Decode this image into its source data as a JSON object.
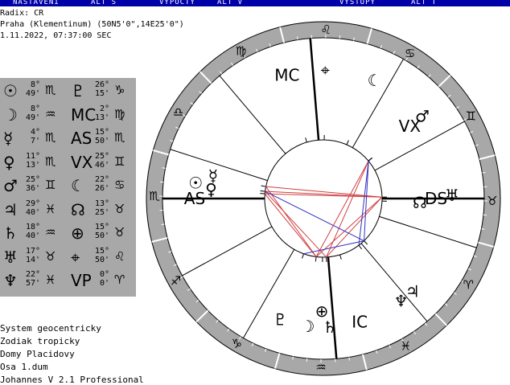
{
  "menu": [
    {
      "label": "NASTAVENI"
    },
    {
      "label": "ALT S"
    },
    {
      "label": "VYPOCTY"
    },
    {
      "label": "ALT V"
    },
    {
      "label": "VYSTUPY"
    },
    {
      "label": "ALT T"
    }
  ],
  "header": {
    "radix": "Radix: CR",
    "place": "Praha (Klementinum) (50N5'0\",14E25'0\")",
    "datetime": "1.11.2022, 07:37:00 SEC"
  },
  "table": [
    {
      "glyph": "☉",
      "deg": "8°",
      "min": "49'",
      "sign": "♏",
      "glyph2": "♇",
      "deg2": "26°",
      "min2": "15'",
      "sign2": "♑"
    },
    {
      "glyph": "☽",
      "deg": "8°",
      "min": "49'",
      "sign": "♒",
      "glyph2": "MC",
      "deg2": "2°",
      "min2": "13'",
      "sign2": "♍"
    },
    {
      "glyph": "☿",
      "deg": "4°",
      "min": "7'",
      "sign": "♏",
      "glyph2": "AS",
      "deg2": "15°",
      "min2": "50'",
      "sign2": "♏"
    },
    {
      "glyph": "♀",
      "deg": "11°",
      "min": "13'",
      "sign": "♏",
      "glyph2": "VX",
      "deg2": "25°",
      "min2": "46'",
      "sign2": "♊"
    },
    {
      "glyph": "♂",
      "deg": "25°",
      "min": "36'",
      "sign": "♊",
      "glyph2": "☾",
      "deg2": "22°",
      "min2": "26'",
      "sign2": "♋"
    },
    {
      "glyph": "♃",
      "deg": "29°",
      "min": "40'",
      "sign": "♓",
      "glyph2": "☊",
      "deg2": "13°",
      "min2": "25'",
      "sign2": "♉"
    },
    {
      "glyph": "♄",
      "deg": "18°",
      "min": "40'",
      "sign": "♒",
      "glyph2": "⊕",
      "deg2": "15°",
      "min2": "50'",
      "sign2": "♉"
    },
    {
      "glyph": "♅",
      "deg": "17°",
      "min": "14'",
      "sign": "♉",
      "glyph2": "⌖",
      "deg2": "15°",
      "min2": "50'",
      "sign2": "♌"
    },
    {
      "glyph": "♆",
      "deg": "22°",
      "min": "57'",
      "sign": "♓",
      "glyph2": "VP",
      "deg2": "0°",
      "min2": "0'",
      "sign2": "♈"
    }
  ],
  "footer": {
    "system": "System geocentricky",
    "zodiac": "Zodiak tropicky",
    "houses": "Domy Placidovy",
    "axis": "Osa 1.dum",
    "app": "Johannes V 2.1 Professional"
  },
  "wheel": {
    "signs": [
      "♈",
      "♉",
      "♊",
      "♋",
      "♌",
      "♍",
      "♎",
      "♏",
      "♐",
      "♑",
      "♒",
      "♓"
    ],
    "asc": 225.83,
    "cusps": [
      225.83,
      254.5,
      286.0,
      320.5,
      356.0,
      28.0,
      45.83,
      74.5,
      106.0,
      140.5,
      176.0,
      208.0
    ],
    "points": [
      {
        "g": "☉",
        "name": "sun",
        "lon": 218.82
      },
      {
        "g": "☽",
        "name": "moon",
        "lon": 308.82
      },
      {
        "g": "☿",
        "name": "mercury",
        "lon": 214.12
      },
      {
        "g": "♀",
        "name": "venus",
        "lon": 221.22
      },
      {
        "g": "♂",
        "name": "mars",
        "lon": 85.6
      },
      {
        "g": "♃",
        "name": "jupiter",
        "lon": 359.67
      },
      {
        "g": "♄",
        "name": "saturn",
        "lon": 318.67
      },
      {
        "g": "♅",
        "name": "uranus",
        "lon": 47.23
      },
      {
        "g": "♆",
        "name": "neptune",
        "lon": 352.95
      },
      {
        "g": "♇",
        "name": "pluto",
        "lon": 296.25
      },
      {
        "g": "MC",
        "name": "mc",
        "lon": 152.22
      },
      {
        "g": "IC",
        "name": "ic",
        "lon": 332.22
      },
      {
        "g": "AS",
        "name": "as",
        "lon": 225.83
      },
      {
        "g": "DS",
        "name": "ds",
        "lon": 45.83
      },
      {
        "g": "VX",
        "name": "vx",
        "lon": 85.77
      },
      {
        "g": "☾",
        "name": "lilith",
        "lon": 112.43
      },
      {
        "g": "☊",
        "name": "node",
        "lon": 43.42
      },
      {
        "g": "⊕",
        "name": "fortune",
        "lon": 315.0
      },
      {
        "g": "⌖",
        "name": "part",
        "lon": 135.0
      }
    ],
    "aspects": [
      {
        "a": 218.82,
        "b": 47.23,
        "color": "#d04040"
      },
      {
        "a": 221.22,
        "b": 47.23,
        "color": "#d04040"
      },
      {
        "a": 214.12,
        "b": 47.23,
        "color": "#d04040"
      },
      {
        "a": 218.82,
        "b": 318.67,
        "color": "#d04040"
      },
      {
        "a": 221.22,
        "b": 308.82,
        "color": "#d04040"
      },
      {
        "a": 214.12,
        "b": 308.82,
        "color": "#d04040"
      },
      {
        "a": 308.82,
        "b": 47.23,
        "color": "#d04040"
      },
      {
        "a": 318.67,
        "b": 47.23,
        "color": "#d04040"
      },
      {
        "a": 85.6,
        "b": 318.67,
        "color": "#d04040"
      },
      {
        "a": 85.6,
        "b": 308.82,
        "color": "#d04040"
      },
      {
        "a": 85.6,
        "b": 352.95,
        "color": "#3030c0"
      },
      {
        "a": 85.6,
        "b": 359.67,
        "color": "#3030c0"
      },
      {
        "a": 218.82,
        "b": 359.67,
        "color": "#3030c0"
      },
      {
        "a": 296.25,
        "b": 359.67,
        "color": "#3030c0"
      }
    ],
    "colors": {
      "ring": "#a8a8a8",
      "menubar": "#0000a8",
      "aspect_red": "#d04040",
      "aspect_blue": "#3030c0"
    }
  }
}
